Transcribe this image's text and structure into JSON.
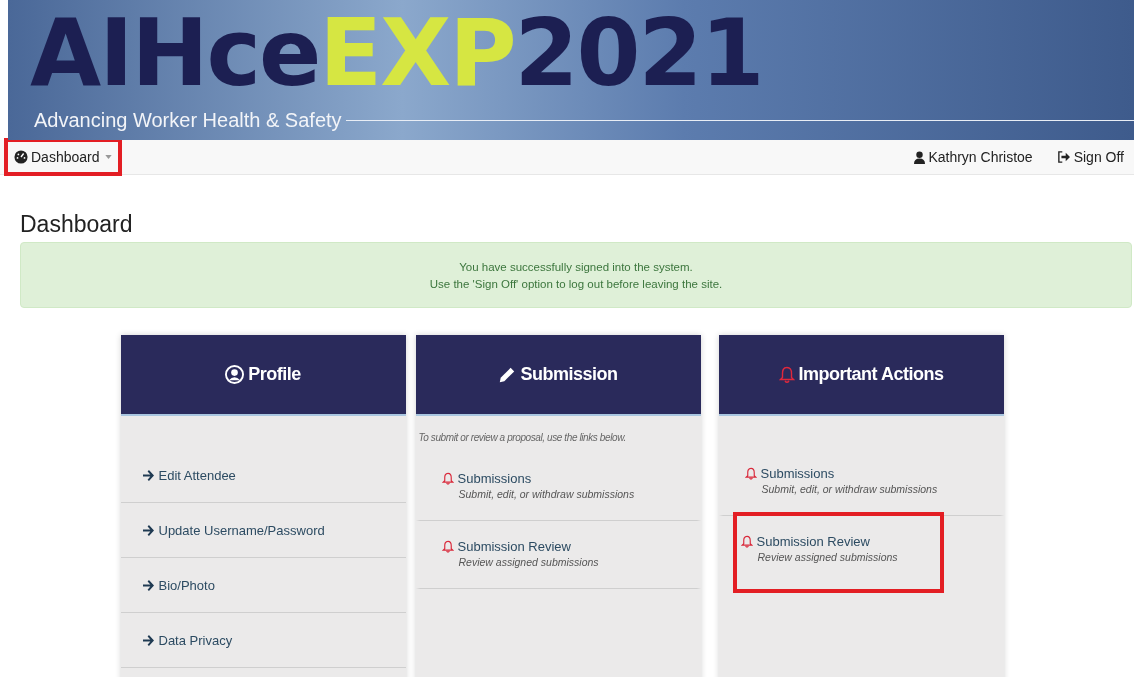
{
  "banner": {
    "logo": {
      "primary": "AIHce",
      "accent": "EXP",
      "year": "2021"
    },
    "tagline": "Advancing Worker Health & Safety"
  },
  "navbar": {
    "menu": {
      "label": "Dashboard",
      "highlighted": true
    },
    "user": "Kathryn Christoe",
    "sign_off": "Sign Off"
  },
  "page_title": "Dashboard",
  "alert": {
    "lines": [
      "You have successfully signed into the system.",
      "Use the 'Sign Off' option to log out before leaving the site."
    ]
  },
  "cards": [
    {
      "title": "Profile",
      "items": [
        {
          "kind": "arrow",
          "label": "Edit Attendee"
        },
        {
          "kind": "arrow",
          "label": "Update Username/Password"
        },
        {
          "kind": "arrow",
          "label": "Bio/Photo"
        },
        {
          "kind": "arrow",
          "label": "Data Privacy"
        }
      ]
    },
    {
      "title": "Submission",
      "intro": "To submit or review a proposal, use the links below.",
      "items": [
        {
          "kind": "bell",
          "label": "Submissions",
          "description": "Submit, edit, or withdraw submissions",
          "highlighted": false
        },
        {
          "kind": "bell",
          "label": "Submission Review",
          "description": "Review assigned submissions",
          "highlighted": false
        }
      ]
    },
    {
      "title": "Important Actions",
      "items": [
        {
          "kind": "bell",
          "label": "Submissions",
          "description": "Submit, edit, or withdraw submissions",
          "highlighted": false
        },
        {
          "kind": "bell",
          "label": "Submission Review",
          "description": "Review assigned submissions",
          "highlighted": true
        }
      ]
    }
  ]
}
